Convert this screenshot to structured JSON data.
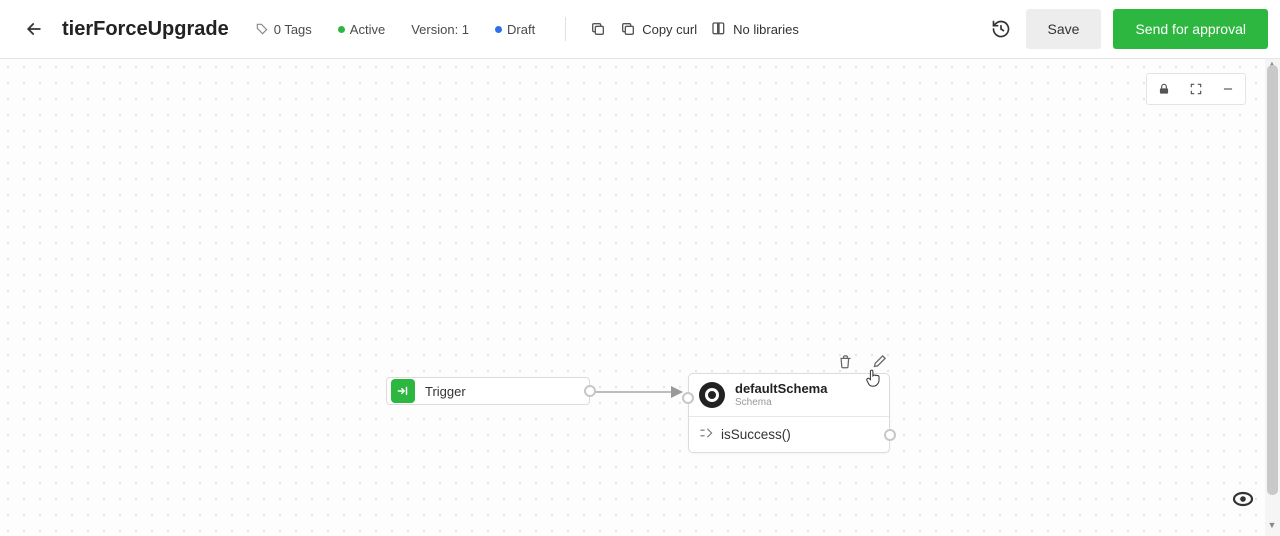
{
  "header": {
    "title": "tierForceUpgrade",
    "tags_label": "0 Tags",
    "status_label": "Active",
    "version_label": "Version: 1",
    "draft_label": "Draft",
    "copy_curl_label": "Copy curl",
    "no_libraries_label": "No libraries",
    "save_label": "Save",
    "approve_label": "Send for approval"
  },
  "nodes": {
    "trigger": {
      "label": "Trigger"
    },
    "schema": {
      "title": "defaultSchema",
      "subtitle": "Schema",
      "row_label": "isSuccess()"
    }
  }
}
